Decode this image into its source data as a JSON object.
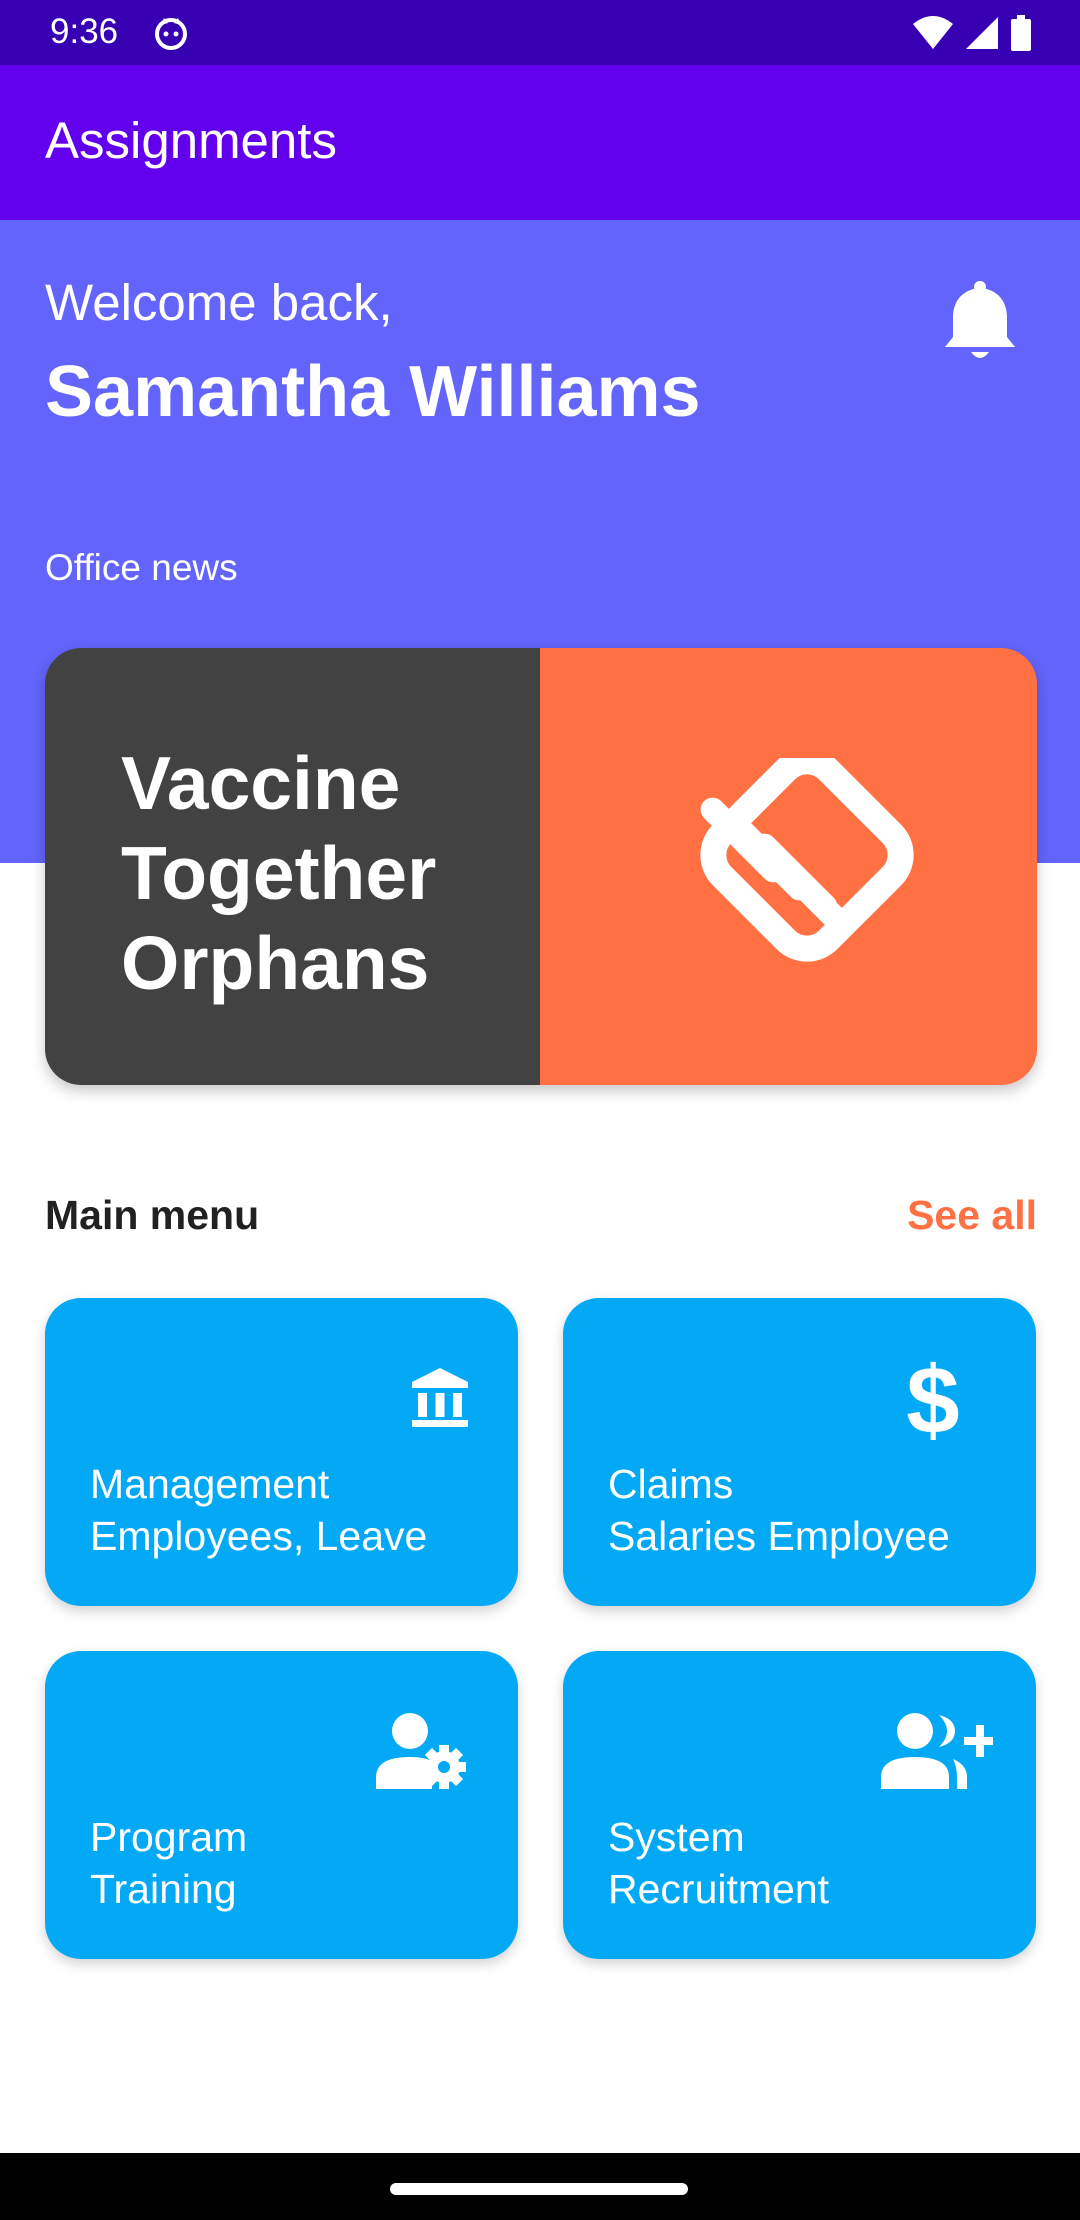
{
  "status_bar": {
    "time": "9:36",
    "icons": [
      "cat-notification-icon",
      "wifi-icon",
      "signal-icon",
      "battery-icon"
    ]
  },
  "app_bar": {
    "title": "Assignments",
    "color": "#6200ee"
  },
  "hero": {
    "welcome": "Welcome back,",
    "user_name": "Samantha Williams",
    "bell_icon": "bell-icon",
    "section_label": "Office news",
    "color": "#6264fb"
  },
  "news_card": {
    "title": "Vaccine\nTogether\nOrphans",
    "icon": "handshake-icon",
    "left_color": "#424242",
    "right_color": "#ff7043"
  },
  "main_menu": {
    "label": "Main menu",
    "see_all": "See all",
    "tiles": [
      {
        "line1": "Management",
        "line2": "Employees, Leave",
        "icon": "bank-icon"
      },
      {
        "line1": "Claims",
        "line2": "Salaries Employee",
        "icon": "dollar-icon"
      },
      {
        "line1": "Program",
        "line2": "Training",
        "icon": "user-settings-icon"
      },
      {
        "line1": "System",
        "line2": "Recruitment",
        "icon": "add-user-icon"
      }
    ],
    "tile_color": "#03a9f4"
  }
}
